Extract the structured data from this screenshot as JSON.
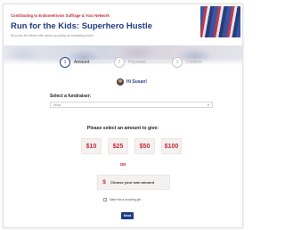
{
  "header": {
    "kicker": "Contributing to Endometriosis Suffrage & Your Network",
    "title": "Run for the Kids: Superhero Hustle",
    "subtitle": "Be a hero for children with cancer by joining our fundraising event."
  },
  "steps": [
    {
      "number": "1",
      "label": "Amount",
      "active": true
    },
    {
      "number": "2",
      "label": "Payment",
      "active": false
    },
    {
      "number": "3",
      "label": "Confirm",
      "active": false
    }
  ],
  "user": {
    "greeting": "Hi Susan!"
  },
  "fundraiser": {
    "label": "Select a fundraiser:",
    "selected": "None"
  },
  "amounts": {
    "prompt": "Please select an amount to give:",
    "options": [
      "$10",
      "$25",
      "$50",
      "$100"
    ],
    "or_label": "OR",
    "own_symbol": "$",
    "own_label": "Choose your own amount"
  },
  "recurring": {
    "label": "Make this a recurring gift."
  },
  "next_button": "Next",
  "colors": {
    "brand_navy": "#1f3a86",
    "accent_red": "#c8283a"
  }
}
